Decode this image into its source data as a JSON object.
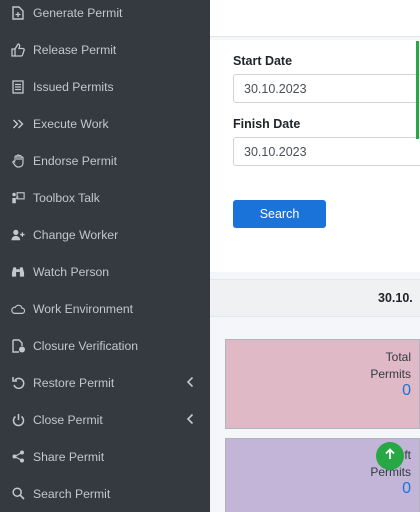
{
  "sidebar": {
    "items": [
      {
        "label": "Generate Permit",
        "icon": "file-plus-icon"
      },
      {
        "label": "Release Permit",
        "icon": "thumbs-up-icon"
      },
      {
        "label": "Issued Permits",
        "icon": "document-list-icon"
      },
      {
        "label": "Execute Work",
        "icon": "double-chevron-right-icon"
      },
      {
        "label": "Endorse Permit",
        "icon": "hand-icon"
      },
      {
        "label": "Toolbox Talk",
        "icon": "presenter-icon"
      },
      {
        "label": "Change Worker",
        "icon": "user-plus-icon"
      },
      {
        "label": "Watch Person",
        "icon": "binoculars-icon"
      },
      {
        "label": "Work Environment",
        "icon": "cloud-icon"
      },
      {
        "label": "Closure Verification",
        "icon": "file-check-icon"
      },
      {
        "label": "Restore Permit",
        "icon": "undo-icon"
      },
      {
        "label": "Close Permit",
        "icon": "power-icon"
      },
      {
        "label": "Share Permit",
        "icon": "share-icon"
      },
      {
        "label": "Search Permit",
        "icon": "search-icon"
      }
    ]
  },
  "filters": {
    "start_label": "Start Date",
    "start_value": "30.10.2023",
    "finish_label": "Finish Date",
    "finish_value": "30.10.2023",
    "search_label": "Search"
  },
  "date_bar": {
    "text": "30.10."
  },
  "stats": {
    "total": {
      "title_line1": "Total",
      "title_line2": "Permits",
      "value": "0"
    },
    "draft": {
      "title_line1": "ft",
      "title_line2": "Permits",
      "value": "0"
    }
  },
  "colors": {
    "sidebar_bg": "#343a40",
    "accent_blue": "#1a73d9",
    "green": "#28a745",
    "total_card": "#dfb9c5",
    "draft_card": "#c2b5d8"
  }
}
